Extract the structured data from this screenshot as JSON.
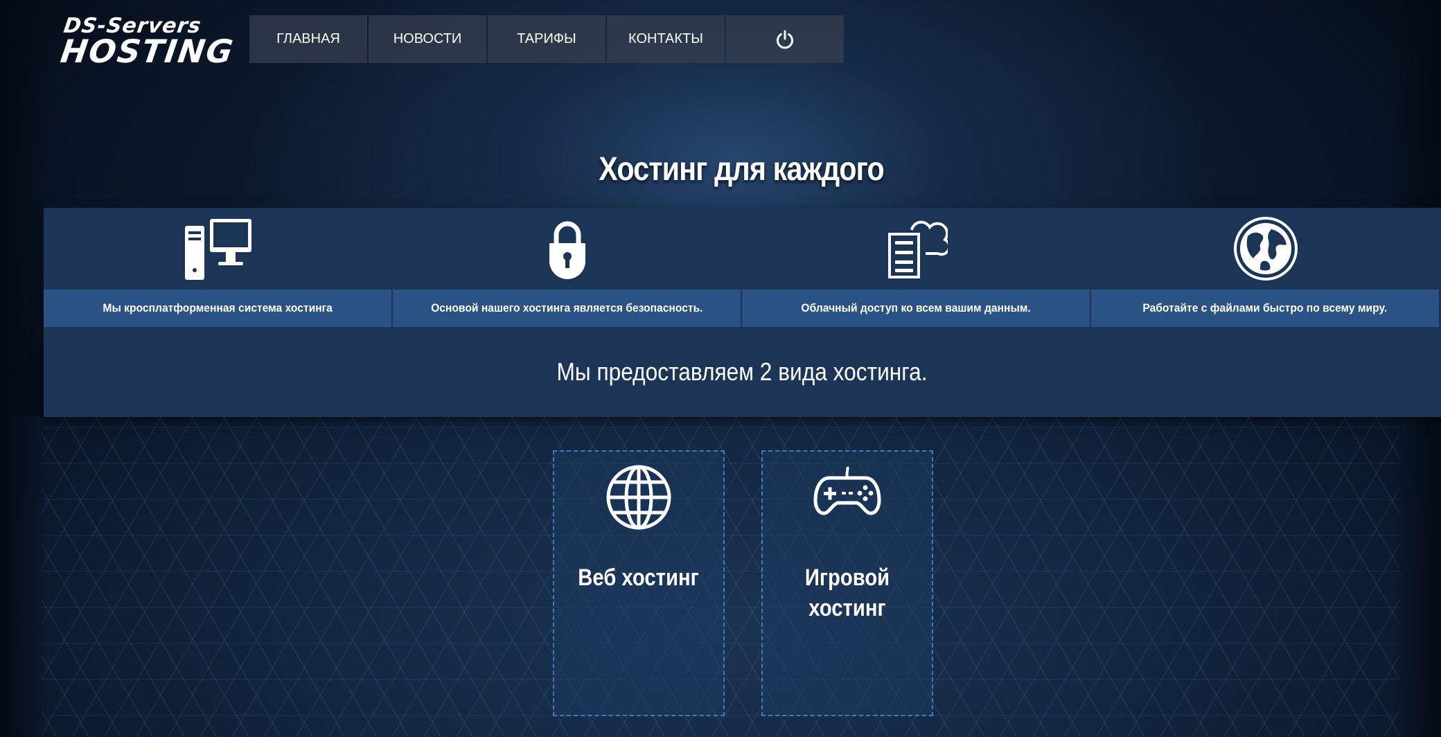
{
  "header": {
    "logo_line1": "DS-Servers",
    "logo_line2": "HOSTING",
    "nav": [
      {
        "label": "ГЛАВНАЯ"
      },
      {
        "label": "НОВОСТИ"
      },
      {
        "label": "ТАРИФЫ"
      },
      {
        "label": "КОНТАКТЫ"
      }
    ],
    "power_icon": "power-icon"
  },
  "hero": {
    "title": "Хостинг для каждого"
  },
  "features": {
    "items": [
      {
        "icon": "desktop-computer-icon",
        "caption": "Мы кросплатформенная система хостинга"
      },
      {
        "icon": "padlock-icon",
        "caption": "Основой нашего хостинга является безопасность."
      },
      {
        "icon": "cloud-server-icon",
        "caption": "Облачный доступ ко всем вашим данным."
      },
      {
        "icon": "globe-world-icon",
        "caption": "Работайте с файлами быстро по всему миру."
      }
    ],
    "subtitle": "Мы предоставляем 2 вида хостинга."
  },
  "hosting_types": [
    {
      "icon": "web-globe-icon",
      "title": "Веб хостинг"
    },
    {
      "icon": "gamepad-icon",
      "title": "Игровой хостинг"
    }
  ],
  "colors": {
    "feature_band": "#1c3456",
    "caption_band": "#2a5285",
    "nav_bg": "#343e4e",
    "card_border": "#3f7ac4"
  }
}
